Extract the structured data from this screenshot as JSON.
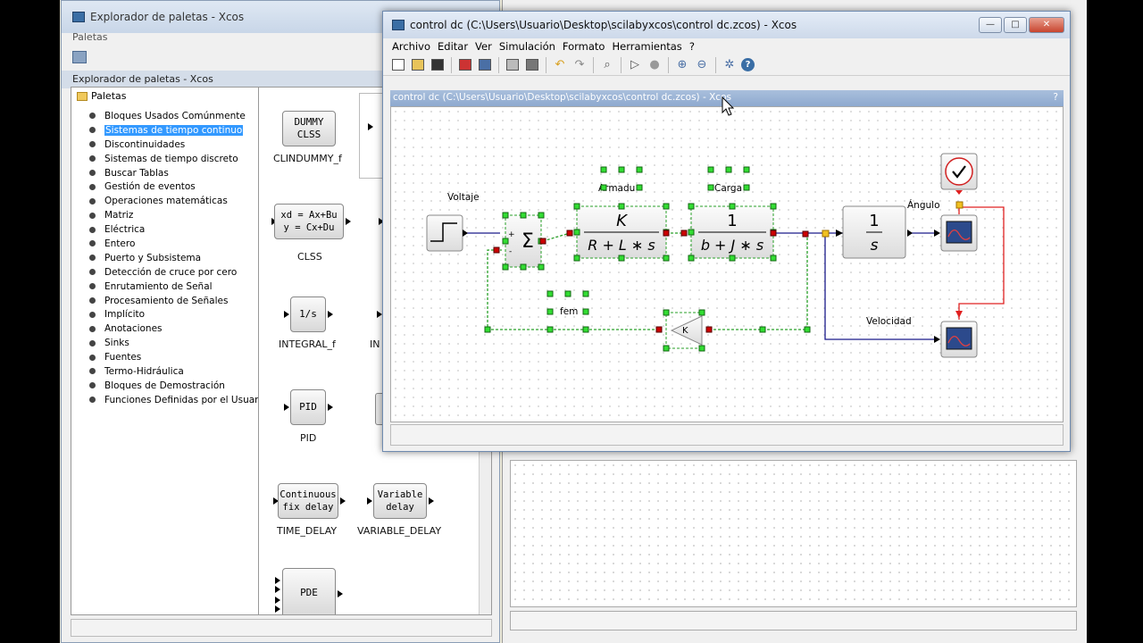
{
  "palette_window": {
    "title": "Explorador de paletas - Xcos",
    "menu": "Paletas",
    "subtitle": "Explorador de paletas - Xcos",
    "tree_root": "Paletas",
    "tree_items": [
      "Bloques Usados Comúnmente",
      "Sistemas de tiempo continuo",
      "Discontinuidades",
      "Sistemas de tiempo discreto",
      "Buscar Tablas",
      "Gestión de eventos",
      "Operaciones matemáticas",
      "Matriz",
      "Eléctrica",
      "Entero",
      "Puerto y Subsistema",
      "Detección de cruce por cero",
      "Enrutamiento de Señal",
      "Procesamiento de Señales",
      "Implícito",
      "Anotaciones",
      "Sinks",
      "Fuentes",
      "Termo-Hidráulica",
      "Bloques de Demostración",
      "Funciones Definidas por el Usuario"
    ],
    "selected_item": "Sistemas de tiempo continuo",
    "blocks": {
      "dummy_line1": "DUMMY",
      "dummy_line2": "CLSS",
      "dummy_name": "CLINDUMMY_f",
      "clss_line1": "xd = Ax+Bu",
      "clss_line2": "y = Cx+Du",
      "clss_name": "CLSS",
      "integral_label": "1/s",
      "integral_name": "INTEGRAL_f",
      "integral_cut": "IN",
      "pid_label": "PID",
      "pid_name": "PID",
      "timedelay_line1": "Continuous",
      "timedelay_line2": "fix delay",
      "timedelay_name": "TIME_DELAY",
      "vardelay_line1": "Variable",
      "vardelay_line2": "delay",
      "vardelay_name": "VARIABLE_DELAY",
      "pde_label": "PDE"
    }
  },
  "main_window": {
    "title": "control dc (C:\\Users\\Usuario\\Desktop\\scilabyxcos\\control dc.zcos) - Xcos",
    "menu": [
      "Archivo",
      "Editar",
      "Ver",
      "Simulación",
      "Formato",
      "Herramientas",
      "?"
    ],
    "subtitle": "control dc (C:\\Users\\Usuario\\Desktop\\scilabyxcos\\control dc.zcos) - Xcos",
    "help_glyph": "?",
    "window_buttons": {
      "minimize": "—",
      "maximize": "□",
      "close": "✕"
    }
  },
  "diagram": {
    "label_voltaje": "Voltaje",
    "label_armadura": "Armadu",
    "label_carga": "Carga",
    "label_angulo": "Ángulo",
    "label_velocidad": "Velocidad",
    "label_fem": "fem",
    "sum_symbol": "Σ",
    "sum_plus": "+",
    "sum_minus": "-",
    "tf1_num": "K",
    "tf1_den": "R + L ∗ s",
    "tf2_num": "1",
    "tf2_den": "b + J ∗ s",
    "int_num": "1",
    "int_den": "s",
    "gain_label": "K"
  },
  "colors": {
    "selection": "#3399ff",
    "link_blue": "#1a1a8a",
    "link_green": "#2aa02a",
    "event_red": "#e02020",
    "port_red": "#cc0000"
  }
}
